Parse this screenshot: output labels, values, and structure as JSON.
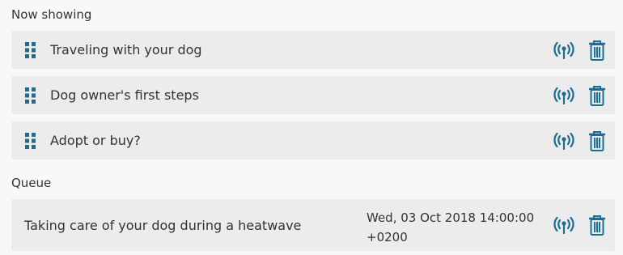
{
  "now_showing": {
    "title": "Now showing",
    "items": [
      {
        "label": "Traveling with your dog"
      },
      {
        "label": "Dog owner's first steps"
      },
      {
        "label": "Adopt or buy?"
      }
    ]
  },
  "queue": {
    "title": "Queue",
    "items": [
      {
        "label": "Taking care of your dog during a heatwave",
        "date_line1": "Wed, 03 Oct 2018 14:00:00",
        "date_line2": "+0200"
      }
    ]
  },
  "icons": {
    "drag": "drag-handle-icon",
    "broadcast": "broadcast-icon",
    "delete": "trash-icon"
  },
  "colors": {
    "accent": "#1a6e96",
    "row_bg": "#ececec",
    "page_bg": "#f8f8f8"
  }
}
